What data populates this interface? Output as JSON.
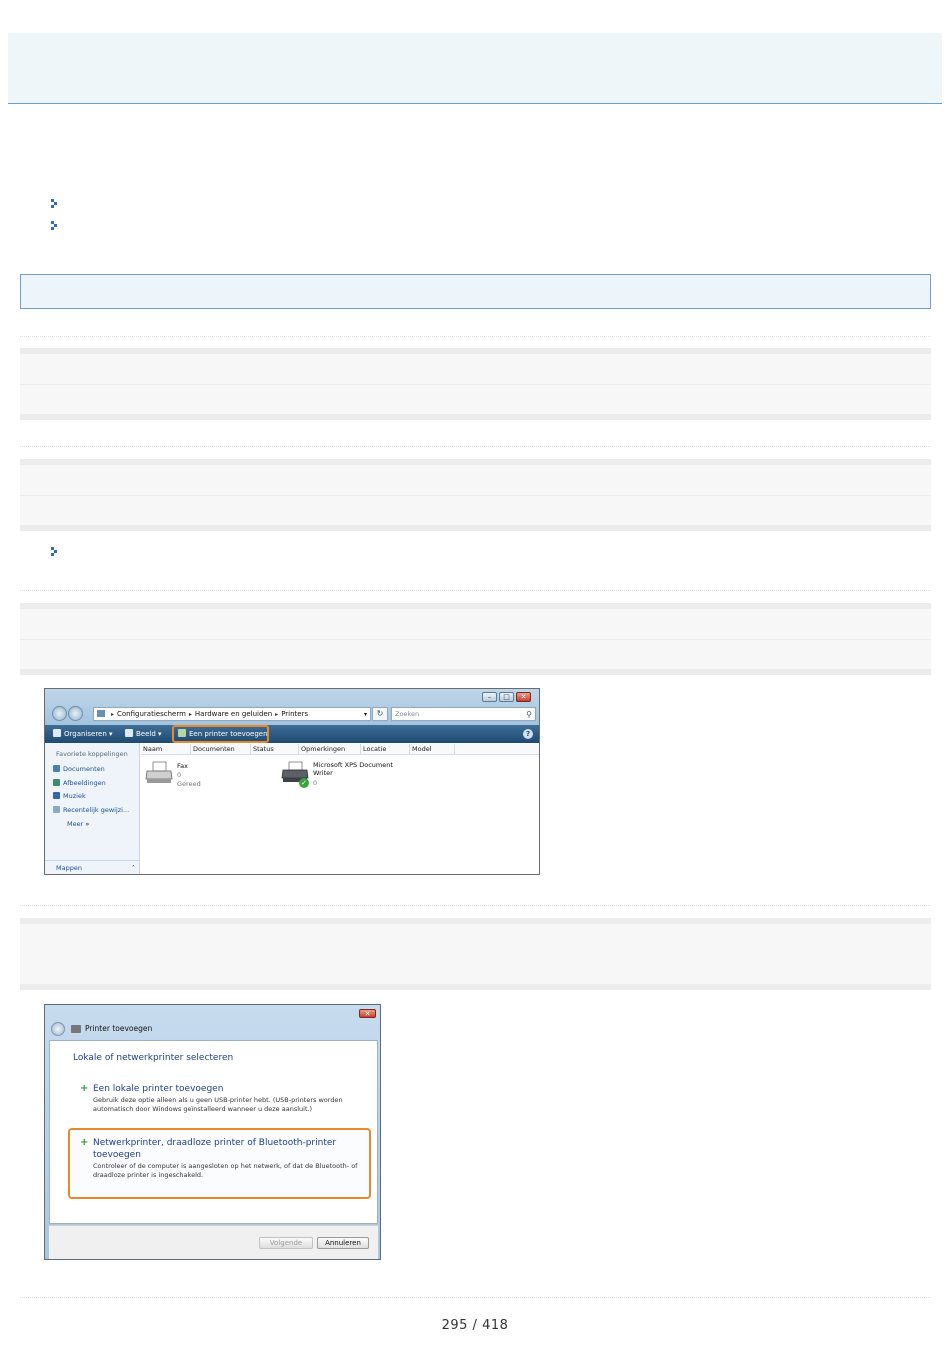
{
  "printers_window": {
    "address": [
      "Configuratiescherm",
      "Hardware en geluiden",
      "Printers"
    ],
    "search_placeholder": "Zoeken",
    "toolbar": {
      "organize": "Organiseren",
      "view": "Beeld",
      "add_printer": "Een printer toevoegen"
    },
    "sidebar": {
      "heading": "Favoriete koppelingen",
      "items": [
        "Documenten",
        "Afbeeldingen",
        "Muziek",
        "Recentelijk gewijzi...",
        "Meer"
      ],
      "more_arrows": "»",
      "folders": "Mappen"
    },
    "columns": [
      "Naam",
      "Documenten",
      "Status",
      "Opmerkingen",
      "Locatie",
      "Model"
    ],
    "printers": [
      {
        "name": "Fax",
        "docs": "0",
        "status": "Gereed"
      },
      {
        "name": "Microsoft XPS Document Writer",
        "docs": "0",
        "status": ""
      }
    ]
  },
  "add_printer_dialog": {
    "title": "Printer toevoegen",
    "heading": "Lokale of netwerkprinter selecteren",
    "option1": {
      "title": "Een lokale printer toevoegen",
      "desc": "Gebruik deze optie alleen als u geen USB-printer hebt. (USB-printers worden automatisch door Windows geïnstalleerd wanneer u deze aansluit.)"
    },
    "option2": {
      "title": "Netwerkprinter, draadloze printer of Bluetooth-printer toevoegen",
      "desc": "Controleer of de computer is aangesloten op het netwerk, of dat de Bluetooth- of draadloze printer is ingeschakeld."
    },
    "next": "Volgende",
    "cancel": "Annuleren"
  },
  "page_number": "295 / 418",
  "colors": {
    "accent_blue": "#6f9fc7",
    "highlight_orange": "#e88a2c",
    "band_gray": "#f7f7f7"
  }
}
